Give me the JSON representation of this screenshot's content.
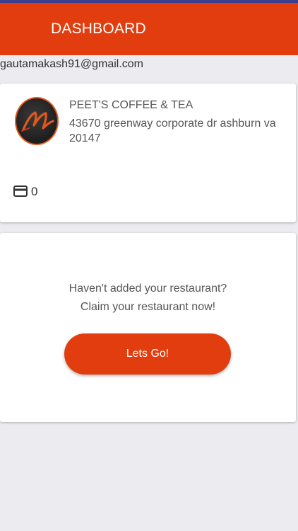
{
  "header": {
    "title": "DASHBOARD"
  },
  "account": {
    "email": "gautamakash91@gmail.com"
  },
  "restaurant": {
    "name": "PEET'S COFFEE & TEA",
    "address": "43670 greenway corporate dr  ashburn va 20147",
    "card_count": "0",
    "icon": "credit-card-icon"
  },
  "claim": {
    "line1": "Haven't added your restaurant?",
    "line2": "Claim your restaurant now!",
    "button_label": "Lets Go!"
  },
  "colors": {
    "brand": "#e23d0e",
    "status_strip": "#3b3f8f",
    "background": "#ebebf0"
  }
}
